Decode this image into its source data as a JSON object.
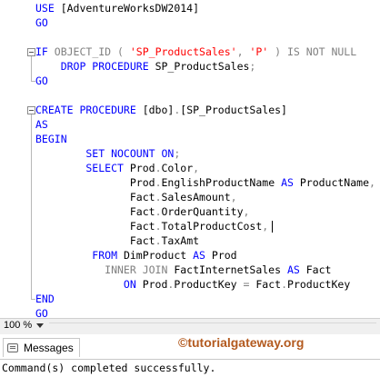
{
  "editor": {
    "lines": [
      {
        "tokens": [
          {
            "t": "USE ",
            "c": "kw"
          },
          {
            "t": "[AdventureWorksDW2014]",
            "c": "blk"
          }
        ]
      },
      {
        "tokens": [
          {
            "t": "GO",
            "c": "kw"
          }
        ]
      },
      {
        "tokens": []
      },
      {
        "tokens": [
          {
            "t": "IF ",
            "c": "kw"
          },
          {
            "t": "OBJECT_ID",
            "c": "gray"
          },
          {
            "t": " ( ",
            "c": "gray"
          },
          {
            "t": "'SP_ProductSales'",
            "c": "str"
          },
          {
            "t": ", ",
            "c": "gray"
          },
          {
            "t": "'P'",
            "c": "str"
          },
          {
            "t": " ) ",
            "c": "gray"
          },
          {
            "t": "IS NOT NULL",
            "c": "gray"
          }
        ]
      },
      {
        "tokens": [
          {
            "t": "    DROP PROCEDURE ",
            "c": "kw"
          },
          {
            "t": "SP_ProductSales",
            "c": "blk"
          },
          {
            "t": ";",
            "c": "gray"
          }
        ]
      },
      {
        "tokens": [
          {
            "t": "GO",
            "c": "kw"
          }
        ]
      },
      {
        "tokens": []
      },
      {
        "tokens": [
          {
            "t": "CREATE PROCEDURE ",
            "c": "kw"
          },
          {
            "t": "[dbo]",
            "c": "blk"
          },
          {
            "t": ".",
            "c": "gray"
          },
          {
            "t": "[SP_ProductSales]",
            "c": "blk"
          }
        ]
      },
      {
        "tokens": [
          {
            "t": "AS",
            "c": "kw"
          }
        ]
      },
      {
        "tokens": [
          {
            "t": "BEGIN",
            "c": "kw"
          }
        ]
      },
      {
        "tokens": [
          {
            "t": "        SET NOCOUNT ON",
            "c": "kw"
          },
          {
            "t": ";",
            "c": "gray"
          }
        ]
      },
      {
        "tokens": [
          {
            "t": "        SELECT ",
            "c": "kw"
          },
          {
            "t": "Prod",
            "c": "blk"
          },
          {
            "t": ".",
            "c": "gray"
          },
          {
            "t": "Color",
            "c": "blk"
          },
          {
            "t": ",",
            "c": "gray"
          }
        ]
      },
      {
        "tokens": [
          {
            "t": "               Prod",
            "c": "blk"
          },
          {
            "t": ".",
            "c": "gray"
          },
          {
            "t": "EnglishProductName ",
            "c": "blk"
          },
          {
            "t": "AS ",
            "c": "kw"
          },
          {
            "t": "ProductName",
            "c": "blk"
          },
          {
            "t": ",",
            "c": "gray"
          }
        ]
      },
      {
        "tokens": [
          {
            "t": "               Fact",
            "c": "blk"
          },
          {
            "t": ".",
            "c": "gray"
          },
          {
            "t": "SalesAmount",
            "c": "blk"
          },
          {
            "t": ",",
            "c": "gray"
          }
        ]
      },
      {
        "tokens": [
          {
            "t": "               Fact",
            "c": "blk"
          },
          {
            "t": ".",
            "c": "gray"
          },
          {
            "t": "OrderQuantity",
            "c": "blk"
          },
          {
            "t": ",",
            "c": "gray"
          }
        ]
      },
      {
        "tokens": [
          {
            "t": "               Fact",
            "c": "blk"
          },
          {
            "t": ".",
            "c": "gray"
          },
          {
            "t": "TotalProductCost",
            "c": "blk"
          },
          {
            "t": ",",
            "c": "gray"
          }
        ],
        "caret": true
      },
      {
        "tokens": [
          {
            "t": "               Fact",
            "c": "blk"
          },
          {
            "t": ".",
            "c": "gray"
          },
          {
            "t": "TaxAmt",
            "c": "blk"
          }
        ]
      },
      {
        "tokens": [
          {
            "t": "         FROM ",
            "c": "kw"
          },
          {
            "t": "DimProduct ",
            "c": "blk"
          },
          {
            "t": "AS ",
            "c": "kw"
          },
          {
            "t": "Prod",
            "c": "blk"
          }
        ]
      },
      {
        "tokens": [
          {
            "t": "           INNER JOIN ",
            "c": "gray"
          },
          {
            "t": "FactInternetSales ",
            "c": "blk"
          },
          {
            "t": "AS ",
            "c": "kw"
          },
          {
            "t": "Fact",
            "c": "blk"
          }
        ]
      },
      {
        "tokens": [
          {
            "t": "              ON ",
            "c": "kw"
          },
          {
            "t": "Prod",
            "c": "blk"
          },
          {
            "t": ".",
            "c": "gray"
          },
          {
            "t": "ProductKey ",
            "c": "blk"
          },
          {
            "t": "= ",
            "c": "gray"
          },
          {
            "t": "Fact",
            "c": "blk"
          },
          {
            "t": ".",
            "c": "gray"
          },
          {
            "t": "ProductKey",
            "c": "blk"
          }
        ]
      },
      {
        "tokens": [
          {
            "t": "END",
            "c": "kw"
          }
        ]
      },
      {
        "tokens": [
          {
            "t": "GO",
            "c": "kw"
          }
        ]
      }
    ]
  },
  "statusbar": {
    "zoom": "100 %"
  },
  "results": {
    "tab_label": "Messages",
    "watermark": "©tutorialgateway.org",
    "message": "Command(s) completed successfully."
  },
  "colors": {
    "keyword": "#0000ff",
    "string": "#ff0000",
    "operator": "#808080",
    "watermark": "#b35a1f"
  }
}
